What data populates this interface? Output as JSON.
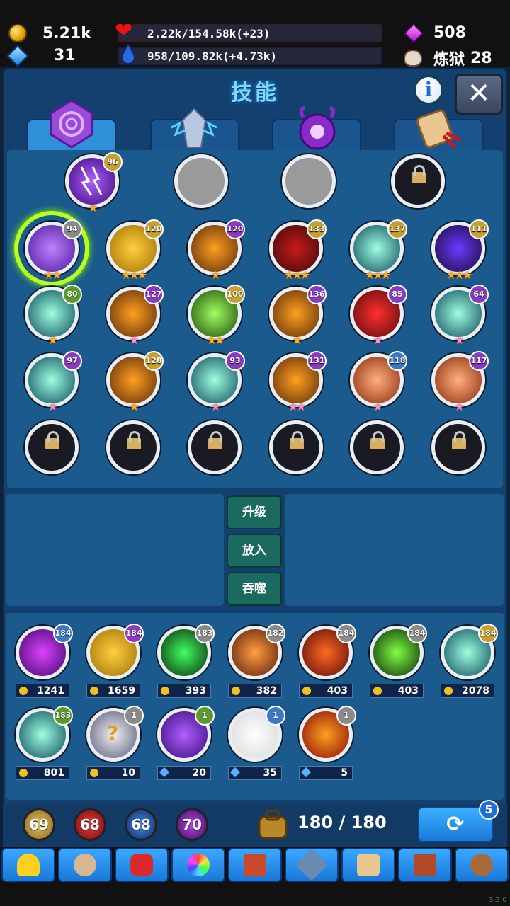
{
  "header": {
    "gold": "5.21k",
    "gems": "31",
    "hp": "2.22k/154.58k(+23)",
    "mana": "958/109.82k(+4.73k)",
    "crystals": "508",
    "dungeon_label": "炼狱",
    "dungeon_level": "28"
  },
  "title": "技能",
  "info_label": "i",
  "close_label": "✕",
  "equipped": [
    {
      "level": "96",
      "stars": "★"
    },
    {
      "state": "empty"
    },
    {
      "state": "empty"
    },
    {
      "state": "locked"
    }
  ],
  "skills_grid": [
    [
      "94",
      "120",
      "120",
      "133",
      "137",
      "111"
    ],
    [
      "80",
      "127",
      "100",
      "136",
      "85",
      "64"
    ],
    [
      "97",
      "128",
      "93",
      "131",
      "118",
      "117"
    ]
  ],
  "actions": {
    "upgrade": "升级",
    "insert": "放入",
    "devour": "吞噬"
  },
  "inventory": [
    {
      "level": "184",
      "price": "1241",
      "currency": "gold"
    },
    {
      "level": "184",
      "price": "1659",
      "currency": "gold"
    },
    {
      "level": "183",
      "price": "393",
      "currency": "gold"
    },
    {
      "level": "182",
      "price": "382",
      "currency": "gold"
    },
    {
      "level": "184",
      "price": "403",
      "currency": "gold"
    },
    {
      "level": "184",
      "price": "403",
      "currency": "gold"
    },
    {
      "level": "184",
      "price": "2078",
      "currency": "gold"
    },
    {
      "level": "183",
      "price": "801",
      "currency": "gold"
    },
    {
      "level": "1",
      "price": "10",
      "currency": "gold"
    },
    {
      "level": "1",
      "price": "20",
      "currency": "gem"
    },
    {
      "level": "1",
      "price": "35",
      "currency": "gem"
    },
    {
      "level": "1",
      "price": "5",
      "currency": "gem"
    }
  ],
  "essence_counts": [
    "69",
    "68",
    "68",
    "70"
  ],
  "bag": "180 / 180",
  "refresh_badge": "5",
  "version": "3.2.0"
}
